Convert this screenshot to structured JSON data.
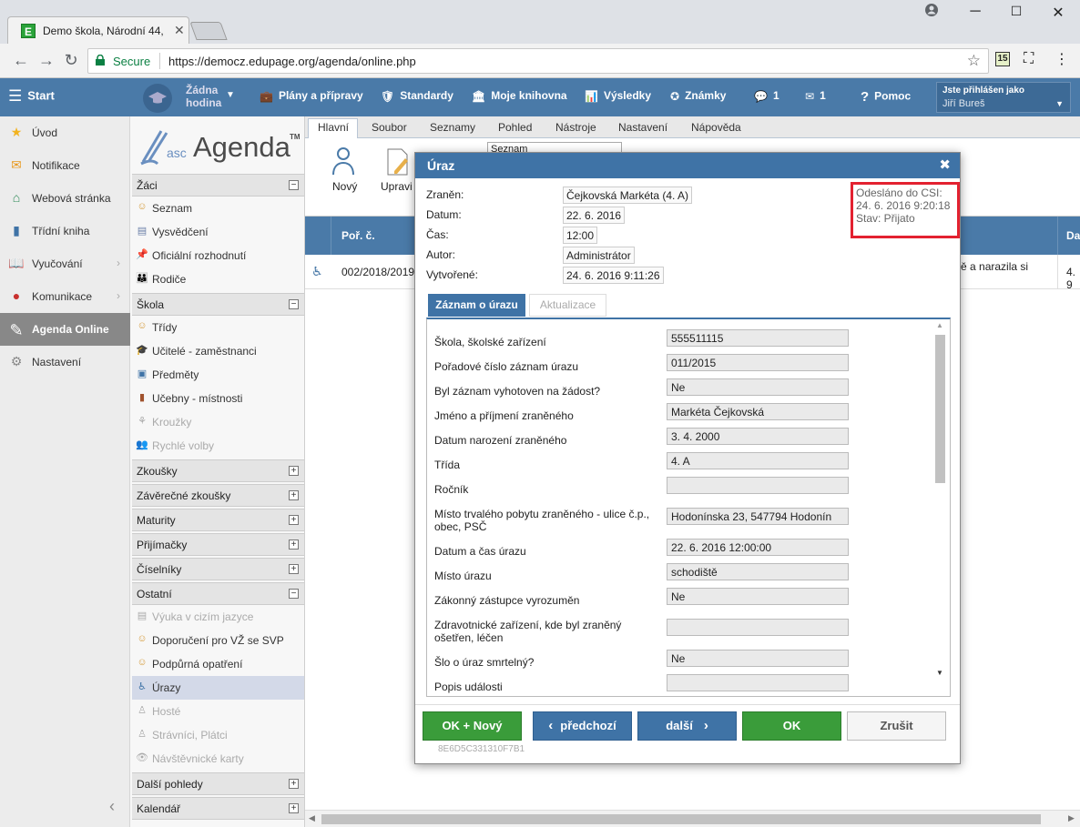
{
  "browser": {
    "tab_title": "Demo škola, Národní 44,",
    "tab_favicon": "E",
    "secure_label": "Secure",
    "url": "https://democz.edupage.org/agenda/online.php",
    "ext_badge": "15"
  },
  "topnav": {
    "start": "Start",
    "hour_line1": "Žádna",
    "hour_line2": "hodina",
    "items": [
      {
        "label": "Plány a přípravy"
      },
      {
        "label": "Standardy"
      },
      {
        "label": "Moje knihovna"
      },
      {
        "label": "Výsledky"
      },
      {
        "label": "Známky"
      },
      {
        "label": "1"
      },
      {
        "label": "1"
      },
      {
        "label": "Pomoc"
      }
    ],
    "user_line1": "Jste přihlášen jako",
    "user_line2": "Jiří Bureš"
  },
  "sidebar": {
    "items": [
      {
        "label": "Úvod"
      },
      {
        "label": "Notifikace"
      },
      {
        "label": "Webová stránka"
      },
      {
        "label": "Třídní kniha"
      },
      {
        "label": "Vyučování"
      },
      {
        "label": "Komunikace"
      },
      {
        "label": "Agenda Online"
      },
      {
        "label": "Nastavení"
      }
    ]
  },
  "agenda": {
    "logo_prefix": "asc",
    "logo_main": "Agenda",
    "logo_tm": "TM",
    "sections": [
      {
        "title": "Žáci",
        "toggle": "−"
      },
      {
        "title": "Škola",
        "toggle": "−"
      },
      {
        "title": "Zkoušky",
        "toggle": "+"
      },
      {
        "title": "Závěrečné zkoušky",
        "toggle": "+"
      },
      {
        "title": "Maturity",
        "toggle": "+"
      },
      {
        "title": "Přijímačky",
        "toggle": "+"
      },
      {
        "title": "Číselníky",
        "toggle": "+"
      },
      {
        "title": "Ostatní",
        "toggle": "−"
      },
      {
        "title": "Další pohledy",
        "toggle": "+"
      },
      {
        "title": "Kalendář",
        "toggle": "+"
      }
    ],
    "zaci_items": [
      "Seznam",
      "Vysvědčení",
      "Oficiální rozhodnutí",
      "Rodiče"
    ],
    "skola_items": [
      "Třídy",
      "Učitelé - zaměstnanci",
      "Předměty",
      "Učebny - místnosti",
      "Kroužky",
      "Rychlé volby"
    ],
    "ostatni_items": [
      "Výuka v cizím jazyce",
      "Doporučení pro VŽ se SVP",
      "Podpůrná opatření",
      "Úrazy",
      "Hosté",
      "Strávníci, Plátci",
      "Návštěvnické karty"
    ]
  },
  "ribbon": {
    "tabs": [
      "Hlavní",
      "Soubor",
      "Seznamy",
      "Pohled",
      "Nástroje",
      "Nastavení",
      "Nápověda"
    ],
    "new_label": "Nový",
    "edit_label": "Upravi",
    "combo_value": "Seznam"
  },
  "grid": {
    "col1": "Poř. č.",
    "col_right": "Da",
    "row_num": "002/2018/2019",
    "row_text": "ě a narazila si",
    "row_right": "4. 9"
  },
  "dialog": {
    "title": "Úraz",
    "header_fields": [
      {
        "label": "Zraněn:",
        "value": "Čejkovská Markéta (4. A)"
      },
      {
        "label": "Datum:",
        "value": "22. 6. 2016"
      },
      {
        "label": "Čas:",
        "value": "12:00"
      },
      {
        "label": "Autor:",
        "value": "Administrátor"
      },
      {
        "label": "Vytvořené:",
        "value": "24. 6. 2016 9:11:26"
      }
    ],
    "csi_line1": "Odesláno do CSI:",
    "csi_line2": "24. 6. 2016 9:20:18",
    "csi_line3": "Stav: Přijato",
    "tab_active": "Záznam o úrazu",
    "tab_other": "Aktualizace",
    "fields": [
      {
        "label": "Škola, školské zařízení",
        "value": "555511115"
      },
      {
        "label": "Pořadové číslo záznam úrazu",
        "value": "011/2015"
      },
      {
        "label": "Byl záznam vyhotoven na žádost?",
        "value": "Ne"
      },
      {
        "label": "Jméno a příjmení zraněného",
        "value": "Markéta Čejkovská"
      },
      {
        "label": "Datum narození zraněného",
        "value": "3. 4. 2000"
      },
      {
        "label": "Třída",
        "value": "4. A"
      },
      {
        "label": "Ročník",
        "value": ""
      },
      {
        "label": "Místo trvalého pobytu zraněného - ulice č.p., obec, PSČ",
        "value": "Hodonínska 23, 547794 Hodonín"
      },
      {
        "label": "Datum a čas úrazu",
        "value": " 22. 6. 2016 12:00:00"
      },
      {
        "label": "Místo úrazu",
        "value": "schodiště"
      },
      {
        "label": "Zákonný zástupce vyrozuměn",
        "value": "Ne"
      },
      {
        "label": "Zdravotnické zařízení, kde byl zraněný ošetřen, léčen",
        "value": ""
      },
      {
        "label": "Šlo o úraz smrtelný?",
        "value": "Ne"
      },
      {
        "label": "Popis události",
        "value": ""
      }
    ],
    "buttons": {
      "ok_new": "OK + Nový",
      "prev": "předchozí",
      "next": "další",
      "ok": "OK",
      "cancel": "Zrušit"
    },
    "hash": "8E6D5C331310F7B1"
  },
  "colors": {
    "accent": "#4a7aa8",
    "dialog_header": "#3f73a6",
    "green": "#3a9c3a",
    "highlight": "#e32130"
  }
}
